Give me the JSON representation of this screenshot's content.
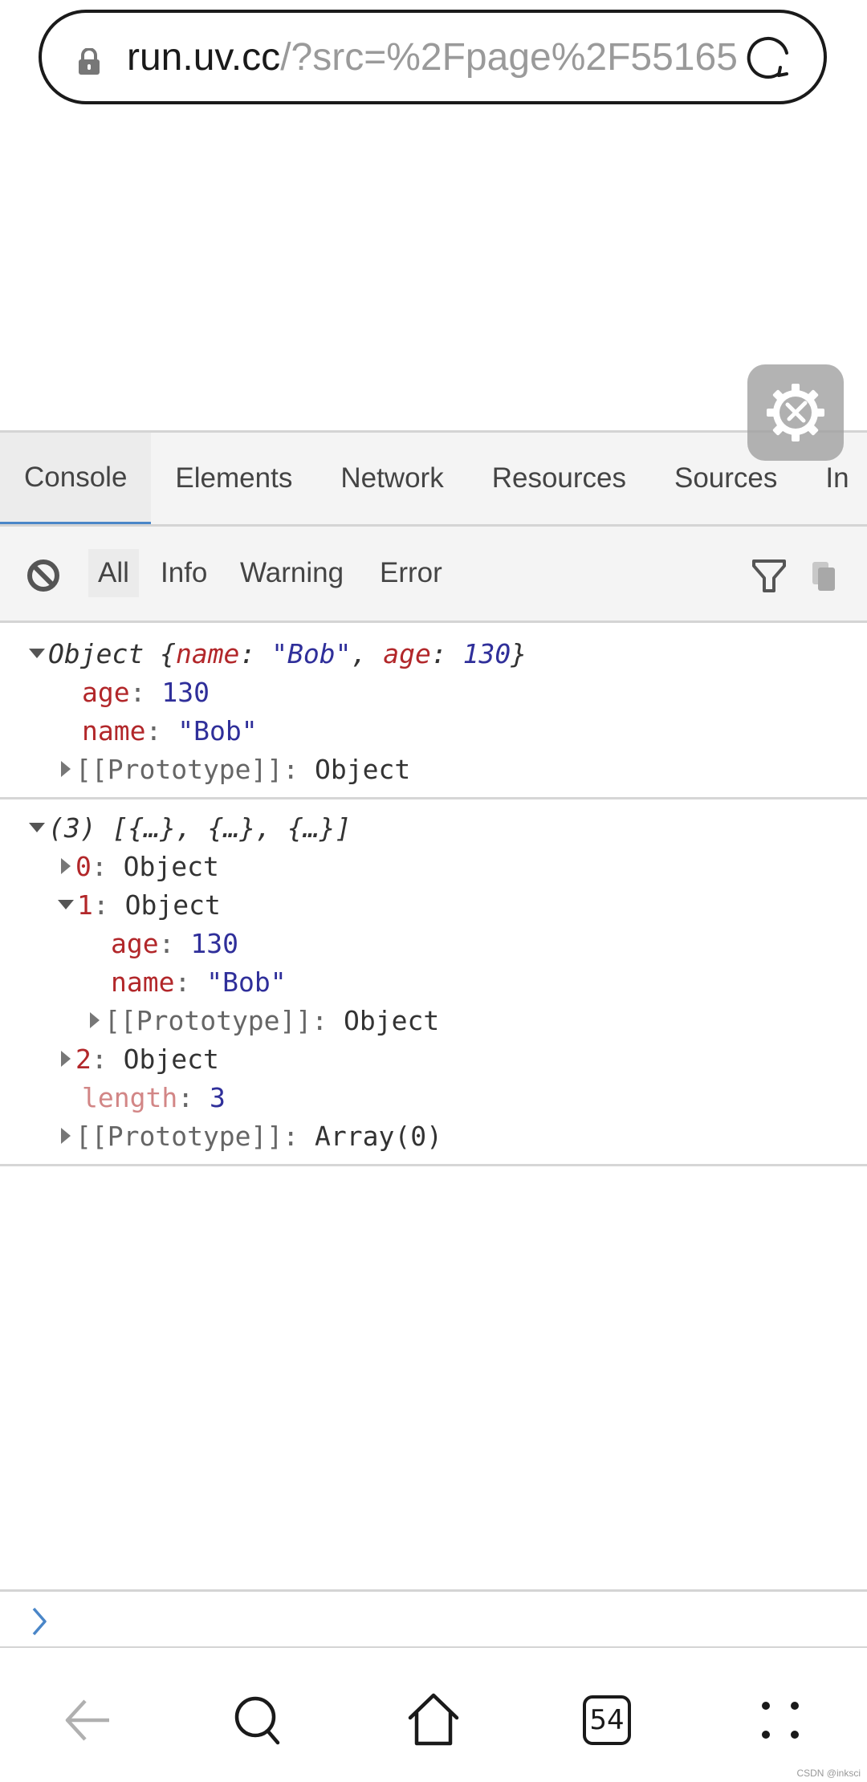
{
  "browser": {
    "url_host": "run.uv.cc",
    "url_path": "/?src=%2Fpage%2F55165",
    "lock_icon": "lock-icon",
    "reload_icon": "reload-icon"
  },
  "devtools": {
    "toggle_icon": "gear-wrench-icon",
    "tabs": [
      {
        "label": "Console",
        "active": true
      },
      {
        "label": "Elements"
      },
      {
        "label": "Network"
      },
      {
        "label": "Resources"
      },
      {
        "label": "Sources"
      },
      {
        "label": "In"
      }
    ],
    "toolbar": {
      "clear_icon": "clear-console-icon",
      "filters": [
        {
          "label": "All",
          "active": true
        },
        {
          "label": "Info"
        },
        {
          "label": "Warning"
        },
        {
          "label": "Error"
        }
      ],
      "filter_icon": "filter-icon",
      "copy_icon": "copy-icon"
    },
    "logs": [
      {
        "summary_prefix": "Object {",
        "summary_key1": "name",
        "summary_sep1": ": ",
        "summary_val1": "\"Bob\"",
        "summary_comma": ", ",
        "summary_key2": "age",
        "summary_sep2": ": ",
        "summary_val2": "130",
        "summary_suffix": "}",
        "props": [
          {
            "key": "age",
            "value": "130"
          },
          {
            "key": "name",
            "value": "\"Bob\""
          }
        ],
        "prototype": {
          "key": "[[Prototype]]",
          "value": "Object"
        }
      },
      {
        "summary": "(3) [{…}, {…}, {…}]",
        "items": [
          {
            "key": "0",
            "value": "Object",
            "expanded": false
          },
          {
            "key": "1",
            "value": "Object",
            "expanded": true,
            "props": [
              {
                "key": "age",
                "value": "130"
              },
              {
                "key": "name",
                "value": "\"Bob\""
              }
            ],
            "prototype": {
              "key": "[[Prototype]]",
              "value": "Object"
            }
          },
          {
            "key": "2",
            "value": "Object",
            "expanded": false
          }
        ],
        "length": {
          "key": "length",
          "value": "3"
        },
        "prototype": {
          "key": "[[Prototype]]",
          "value": "Array(0)"
        }
      }
    ],
    "prompt_icon": "chevron-right-icon"
  },
  "nav": {
    "back_icon": "back-arrow-icon",
    "search_icon": "search-icon",
    "home_icon": "home-icon",
    "tabs_count": "54",
    "menu_icon": "menu-dots-icon"
  },
  "watermark": "CSDN @inksci",
  "colors": {
    "accent_blue": "#4a86c8",
    "key_red": "#b2272a",
    "value_blue": "#2f2f9a"
  }
}
